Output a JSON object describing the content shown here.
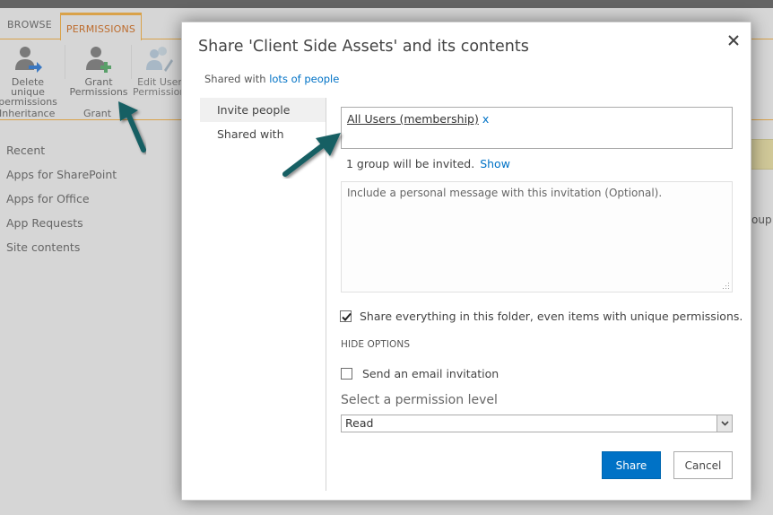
{
  "background": {
    "ribbon_tabs": [
      {
        "label": "BROWSE",
        "active": false
      },
      {
        "label": "PERMISSIONS",
        "active": true
      }
    ],
    "ribbon_buttons": {
      "delete_unique": {
        "line1": "Delete unique",
        "line2": "permissions"
      },
      "grant": {
        "line1": "Grant",
        "line2": "Permissions"
      },
      "edit_user": {
        "line1": "Edit User",
        "line2": "Permissions"
      }
    },
    "ribbon_groups": {
      "inheritance": "Inheritance",
      "grant": "Grant"
    },
    "partial_text_right": "oup",
    "left_nav": [
      {
        "label": "Recent"
      },
      {
        "label": "Apps for SharePoint"
      },
      {
        "label": "Apps for Office"
      },
      {
        "label": "App Requests"
      },
      {
        "label": "Site contents"
      }
    ]
  },
  "dialog": {
    "title": "Share 'Client Side Assets' and its contents",
    "close_icon": "close-icon",
    "shared_with_prefix": "Shared with",
    "shared_with_link": "lots of people",
    "side_tabs": [
      {
        "label": "Invite people",
        "active": true
      },
      {
        "label": "Shared with",
        "active": false
      }
    ],
    "people_picker": {
      "entities": [
        {
          "name": "All Users (membership)",
          "remove": "x"
        }
      ]
    },
    "invite_summary": "1 group will be invited.",
    "show_link": "Show",
    "message_placeholder": "Include a personal message with this invitation (Optional).",
    "message_value": "",
    "share_everything": {
      "label": "Share everything in this folder, even items with unique permissions.",
      "checked": true
    },
    "hide_options": "HIDE OPTIONS",
    "send_email": {
      "label": "Send an email invitation",
      "checked": false
    },
    "permission_label": "Select a permission level",
    "permission_value": "Read",
    "share_button": "Share",
    "cancel_button": "Cancel"
  },
  "colors": {
    "accent": "#0072c6",
    "ribbon_orange": "#d9a24a",
    "annotation_arrow": "#175e63"
  }
}
